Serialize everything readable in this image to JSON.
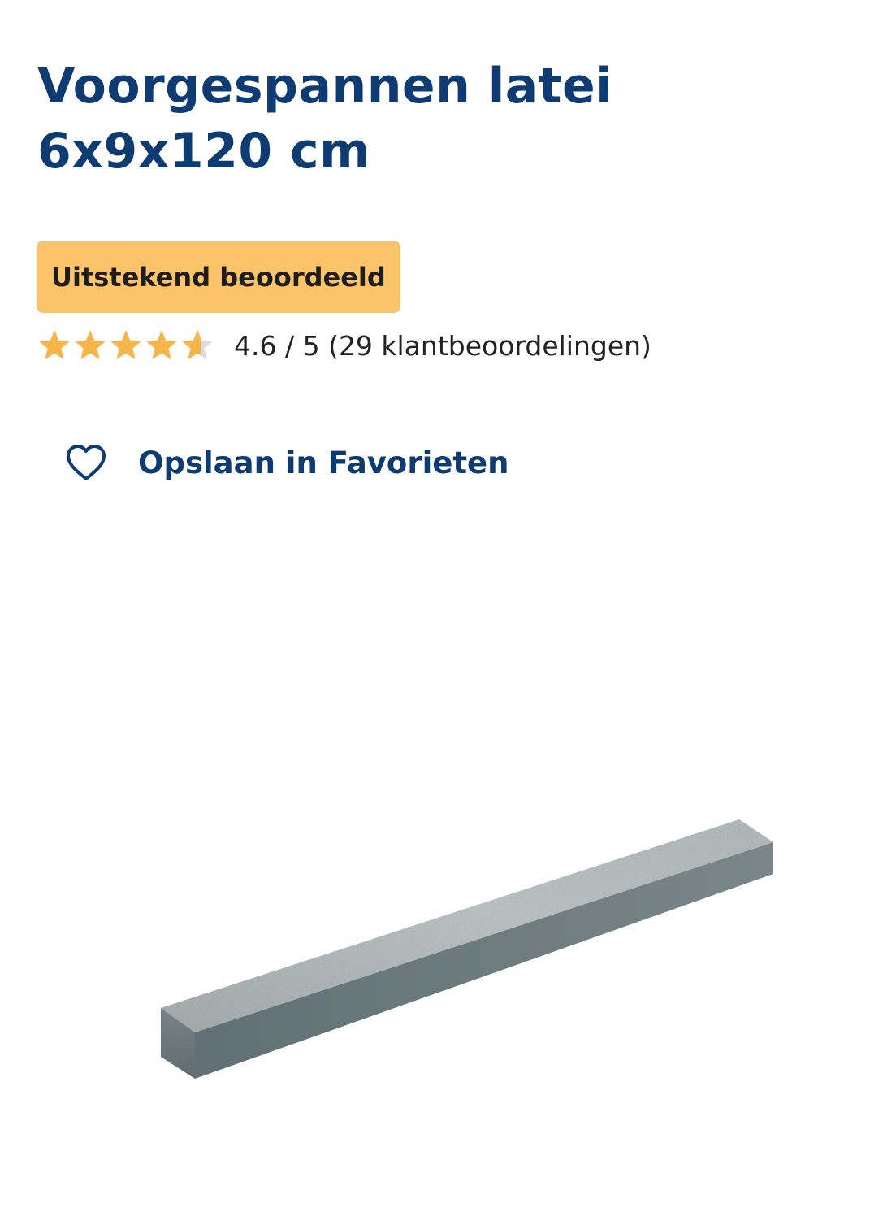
{
  "product": {
    "title": "Voorgespannen latei 6x9x120 cm",
    "rating_badge": "Uitstekend beoordeeld",
    "rating": {
      "value": 4.6,
      "max": 5,
      "text": "4.6 / 5 (29 klantbeoordelingen)"
    },
    "favorites_label": "Opslaan in Favorieten",
    "image_subject": "lintel-product-photo"
  },
  "colors": {
    "title": "#0f3b73",
    "badge_background": "#fcc46a",
    "star_filled": "#f6b54a",
    "star_empty": "#dcdcdc",
    "link": "#0f3b73"
  }
}
